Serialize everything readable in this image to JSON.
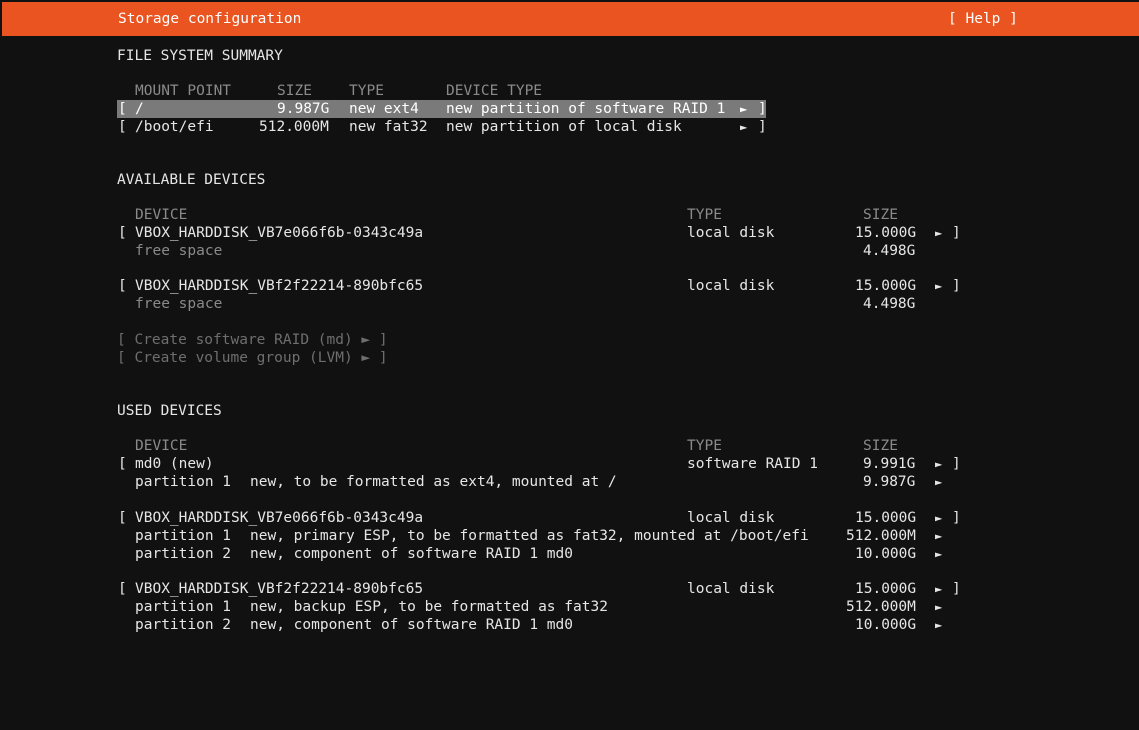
{
  "header": {
    "title": "Storage configuration",
    "help": "[ Help ]"
  },
  "fs_summary": {
    "heading": "FILE SYSTEM SUMMARY",
    "columns": [
      "MOUNT POINT",
      "SIZE",
      "TYPE",
      "DEVICE TYPE"
    ],
    "rows": [
      {
        "mount": "/",
        "size": "9.987G",
        "type": "new ext4",
        "device_type": "new partition of software RAID 1",
        "arrow": "►",
        "close": "]"
      },
      {
        "mount": "/boot/efi",
        "size": "512.000M",
        "type": "new fat32",
        "device_type": "new partition of local disk",
        "arrow": "►",
        "close": "]"
      }
    ]
  },
  "available": {
    "heading": "AVAILABLE DEVICES",
    "columns": [
      "DEVICE",
      "TYPE",
      "SIZE"
    ],
    "devices": [
      {
        "name": "VBOX_HARDDISK_VB7e066f6b-0343c49a",
        "type": "local disk",
        "size": "15.000G",
        "arrow": "►",
        "close": "]",
        "free_label": "free space",
        "free_size": "4.498G"
      },
      {
        "name": "VBOX_HARDDISK_VBf2f22214-890bfc65",
        "type": "local disk",
        "size": "15.000G",
        "arrow": "►",
        "close": "]",
        "free_label": "free space",
        "free_size": "4.498G"
      }
    ],
    "actions": [
      "[ Create software RAID (md) ► ]",
      "[ Create volume group (LVM) ► ]"
    ]
  },
  "used": {
    "heading": "USED DEVICES",
    "columns": [
      "DEVICE",
      "TYPE",
      "SIZE"
    ],
    "devices": [
      {
        "name": "md0 (new)",
        "type": "software RAID 1",
        "size": "9.991G",
        "arrow": "►",
        "close": "]",
        "partitions": [
          {
            "label": "partition 1",
            "desc": "new, to be formatted as ext4, mounted at /",
            "size": "9.987G",
            "arrow": "►"
          }
        ]
      },
      {
        "name": "VBOX_HARDDISK_VB7e066f6b-0343c49a",
        "type": "local disk",
        "size": "15.000G",
        "arrow": "►",
        "close": "]",
        "partitions": [
          {
            "label": "partition 1",
            "desc": "new, primary ESP, to be formatted as fat32, mounted at /boot/efi",
            "size": "512.000M",
            "arrow": "►"
          },
          {
            "label": "partition 2",
            "desc": "new, component of software RAID 1 md0",
            "size": "10.000G",
            "arrow": "►"
          }
        ]
      },
      {
        "name": "VBOX_HARDDISK_VBf2f22214-890bfc65",
        "type": "local disk",
        "size": "15.000G",
        "arrow": "►",
        "close": "]",
        "partitions": [
          {
            "label": "partition 1",
            "desc": "new, backup ESP, to be formatted as fat32",
            "size": "512.000M",
            "arrow": "►"
          },
          {
            "label": "partition 2",
            "desc": "new, component of software RAID 1 md0",
            "size": "10.000G",
            "arrow": "►"
          }
        ]
      }
    ]
  }
}
